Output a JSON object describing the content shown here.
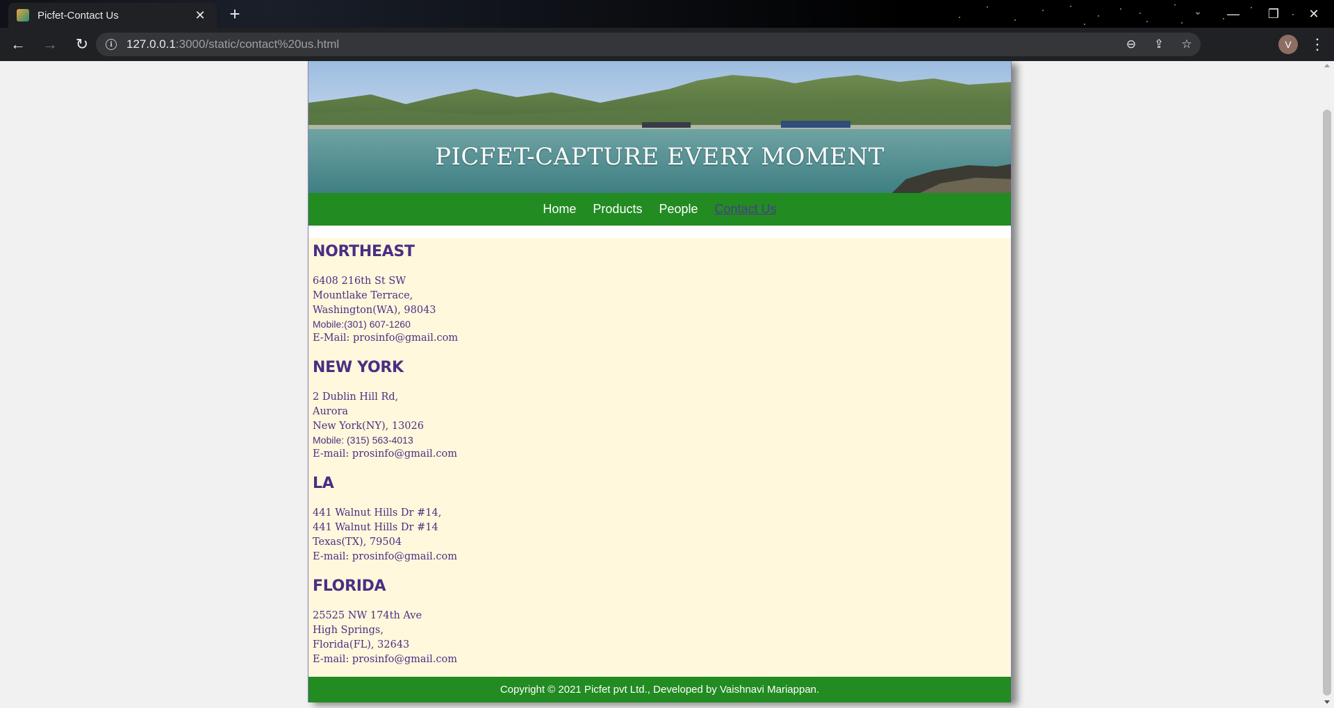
{
  "browser": {
    "tab_title": "Picfet-Contact Us",
    "url_host": "127.0.0.1",
    "url_path": ":3000/static/contact%20us.html",
    "profile_initial": "V"
  },
  "site": {
    "banner_title": "PICFET-CAPTURE EVERY MOMENT",
    "nav": {
      "home": "Home",
      "products": "Products",
      "people": "People",
      "contact": "Contact Us"
    },
    "offices": [
      {
        "name": "NORTHEAST",
        "lines": [
          "6408 216th St SW",
          "Mountlake Terrace,",
          "Washington(WA), 98043"
        ],
        "phone": "Mobile:(301) 607-1260",
        "email": "E-Mail: prosinfo@gmail.com"
      },
      {
        "name": "NEW YORK",
        "lines": [
          "2 Dublin Hill Rd,",
          "Aurora",
          "New York(NY), 13026"
        ],
        "phone": "Mobile: (315) 563-4013",
        "email": "E-mail: prosinfo@gmail.com"
      },
      {
        "name": "LA",
        "lines": [
          "441 Walnut Hills Dr #14,",
          "441 Walnut Hills Dr #14",
          "Texas(TX), 79504"
        ],
        "email": "E-mail: prosinfo@gmail.com"
      },
      {
        "name": "FLORIDA",
        "lines": [
          "25525 NW 174th Ave",
          "High Springs,",
          "Florida(FL), 32643"
        ],
        "email": "E-mail: prosinfo@gmail.com"
      }
    ],
    "footer": "Copyright © 2021 Picfet pvt Ltd., Developed by Vaishnavi Mariappan.",
    "colors": {
      "nav_green": "#228b22",
      "text_purple": "#4b2e83",
      "content_bg": "#fff8dc"
    }
  }
}
